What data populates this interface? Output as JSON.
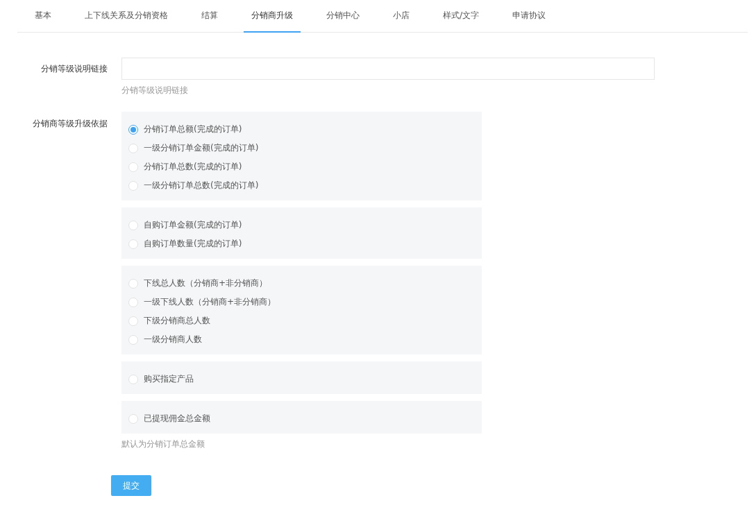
{
  "tabs": [
    {
      "label": "基本",
      "selected": false
    },
    {
      "label": "上下线关系及分销资格",
      "selected": false
    },
    {
      "label": "结算",
      "selected": false
    },
    {
      "label": "分销商升级",
      "selected": true
    },
    {
      "label": "分销中心",
      "selected": false
    },
    {
      "label": "小店",
      "selected": false
    },
    {
      "label": "样式/文字",
      "selected": false
    },
    {
      "label": "申请协议",
      "selected": false
    }
  ],
  "link_field": {
    "label": "分销等级说明链接",
    "help": "分销等级说明链接"
  },
  "upgrade_basis": {
    "label": "分销商等级升级依据",
    "help": "默认为分销订单总金额",
    "groups": [
      {
        "options": [
          {
            "label": "分销订单总额(完成的订单)",
            "selected": true
          },
          {
            "label": "一级分销订单金额(完成的订单)",
            "selected": false
          },
          {
            "label": "分销订单总数(完成的订单)",
            "selected": false
          },
          {
            "label": "一级分销订单总数(完成的订单)",
            "selected": false
          }
        ]
      },
      {
        "options": [
          {
            "label": "自购订单金额(完成的订单)",
            "selected": false
          },
          {
            "label": "自购订单数量(完成的订单)",
            "selected": false
          }
        ]
      },
      {
        "options": [
          {
            "label": "下线总人数（分销商+非分销商）",
            "selected": false
          },
          {
            "label": "一级下线人数（分销商+非分销商）",
            "selected": false
          },
          {
            "label": "下级分销商总人数",
            "selected": false
          },
          {
            "label": "一级分销商人数",
            "selected": false
          }
        ]
      },
      {
        "options": [
          {
            "label": "购买指定产品",
            "selected": false
          }
        ]
      },
      {
        "options": [
          {
            "label": "已提现佣金总金额",
            "selected": false
          }
        ]
      }
    ]
  },
  "submit_button": "提交"
}
